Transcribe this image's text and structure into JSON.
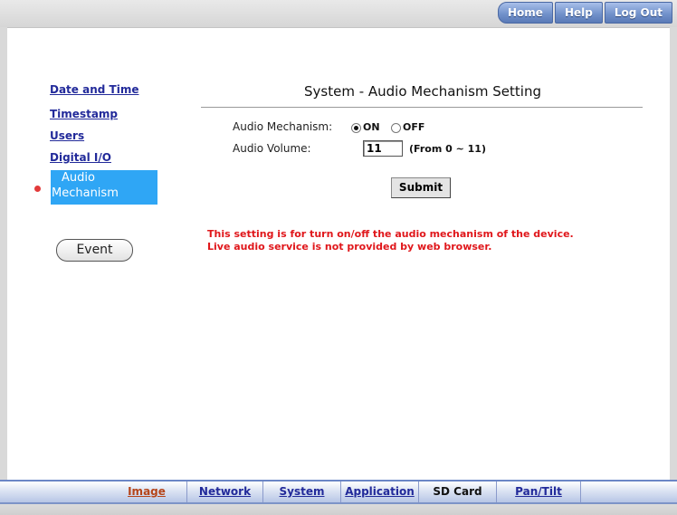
{
  "top_nav": {
    "home": "Home",
    "help": "Help",
    "logout": "Log Out"
  },
  "left_menu": {
    "items": [
      "Date and Time",
      "Timestamp",
      "Users",
      "Digital I/O"
    ],
    "active_line1": "Audio",
    "active_line2": "Mechanism",
    "event_button": "Event"
  },
  "main": {
    "title": "System - Audio Mechanism Setting",
    "mechanism_label": "Audio Mechanism:",
    "on_label": "ON",
    "off_label": "OFF",
    "selected": "ON",
    "volume_label": "Audio Volume:",
    "volume_value": "11",
    "volume_range": "(From 0 ~ 11)",
    "submit": "Submit",
    "warning_line1": "This setting is for turn on/off the audio mechanism of the device.",
    "warning_line2": "Live audio service is not provided by web browser."
  },
  "bottom_tabs": [
    "Image",
    "Network",
    "System",
    "Application",
    "SD Card",
    "Pan/Tilt"
  ],
  "colors": {
    "link": "#222a9a",
    "active_menu": "#2fa6f5",
    "warning": "#e0171b"
  }
}
